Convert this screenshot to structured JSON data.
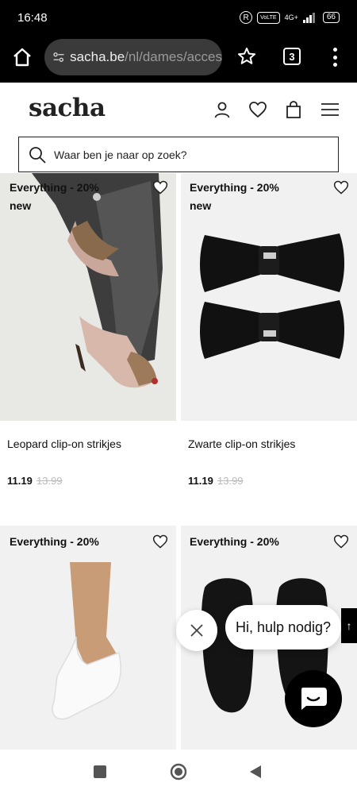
{
  "status_bar": {
    "time": "16:48",
    "r_icon": "R",
    "volte": "VoLTE",
    "network": "4G+",
    "battery": "66"
  },
  "browser": {
    "url_host": "sacha.be",
    "url_path": "/nl/dames/acces",
    "tab_count": "3"
  },
  "header": {
    "logo": "sacha",
    "icons": [
      "user-icon",
      "heart-icon",
      "shopping-bag-icon",
      "menu-icon"
    ]
  },
  "search": {
    "placeholder": "Waar ben je naar op zoek?"
  },
  "products": [
    {
      "badge": "Everything - 20%",
      "tag": "new",
      "name": "Leopard clip-on strikjes",
      "price": "11.19",
      "old_price": "13.99"
    },
    {
      "badge": "Everything - 20%",
      "tag": "new",
      "name": "Zwarte clip-on strikjes",
      "price": "11.19",
      "old_price": "13.99"
    },
    {
      "badge": "Everything - 20%",
      "tag": "",
      "name": "",
      "price": "",
      "old_price": ""
    },
    {
      "badge": "Everything - 20%",
      "tag": "",
      "name": "",
      "price": "",
      "old_price": ""
    }
  ],
  "chat": {
    "bubble_text": "Hi, hulp nodig?",
    "scroll_top_glyph": "↑"
  },
  "colors": {
    "brand": "#222222",
    "chat_button": "#000000",
    "status_bar": "#000000"
  }
}
